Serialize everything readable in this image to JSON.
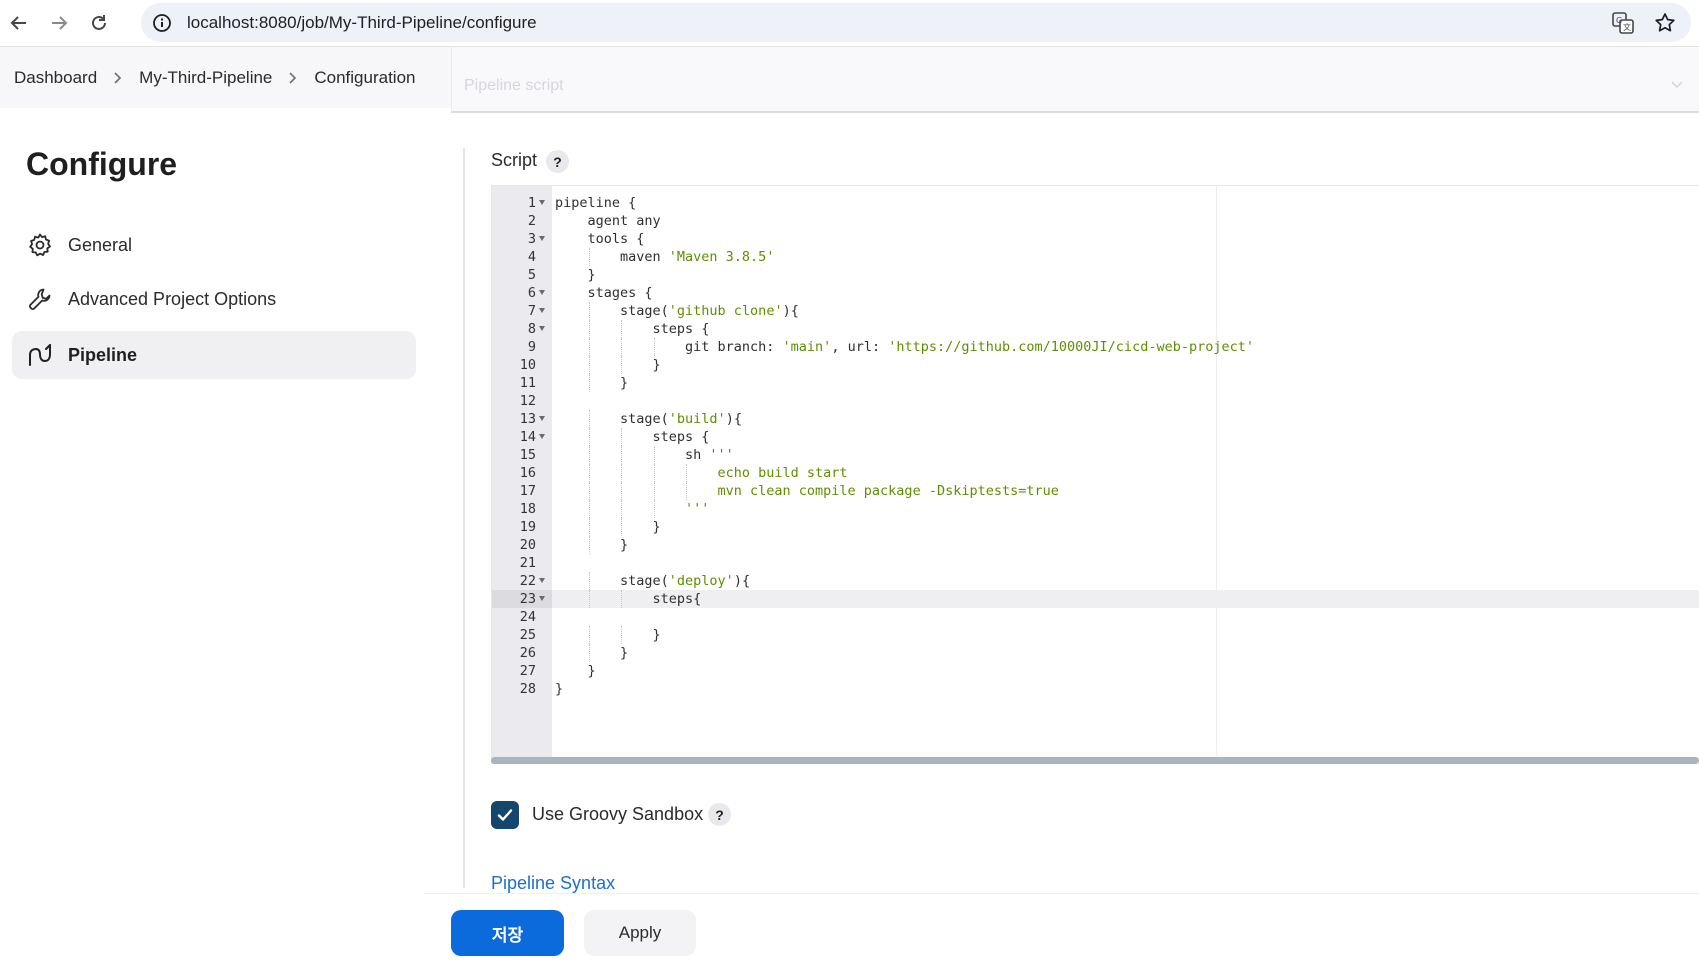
{
  "browser": {
    "url": "localhost:8080/job/My-Third-Pipeline/configure",
    "icons": [
      "back-arrow-icon",
      "forward-arrow-icon",
      "reload-icon",
      "info-icon",
      "translate-icon",
      "star-icon"
    ]
  },
  "breadcrumb": [
    "Dashboard",
    "My-Third-Pipeline",
    "Configuration"
  ],
  "definition_select": {
    "value": "Pipeline script"
  },
  "sidebar": {
    "title": "Configure",
    "items": [
      {
        "label": "General",
        "icon": "gear-icon"
      },
      {
        "label": "Advanced Project Options",
        "icon": "wrench-icon"
      },
      {
        "label": "Pipeline",
        "icon": "pipeline-icon",
        "active": true
      }
    ]
  },
  "script": {
    "label": "Script",
    "help": "?",
    "active_line": 23,
    "lines": [
      {
        "n": "1",
        "fold": true,
        "indent": 0,
        "parts": [
          {
            "t": "pipeline {"
          }
        ]
      },
      {
        "n": "2",
        "fold": false,
        "indent": 1,
        "parts": [
          {
            "t": "agent any"
          }
        ]
      },
      {
        "n": "3",
        "fold": true,
        "indent": 1,
        "parts": [
          {
            "t": "tools {"
          }
        ]
      },
      {
        "n": "4",
        "fold": false,
        "indent": 2,
        "parts": [
          {
            "t": "maven "
          },
          {
            "t": "'Maven 3.8.5'",
            "s": true
          }
        ]
      },
      {
        "n": "5",
        "fold": false,
        "indent": 1,
        "parts": [
          {
            "t": "}"
          }
        ]
      },
      {
        "n": "6",
        "fold": true,
        "indent": 1,
        "parts": [
          {
            "t": "stages {"
          }
        ]
      },
      {
        "n": "7",
        "fold": true,
        "indent": 2,
        "parts": [
          {
            "t": "stage("
          },
          {
            "t": "'github clone'",
            "s": true
          },
          {
            "t": "){"
          }
        ]
      },
      {
        "n": "8",
        "fold": true,
        "indent": 3,
        "parts": [
          {
            "t": "steps {"
          }
        ]
      },
      {
        "n": "9",
        "fold": false,
        "indent": 4,
        "parts": [
          {
            "t": "git branch: "
          },
          {
            "t": "'main'",
            "s": true
          },
          {
            "t": ", url: "
          },
          {
            "t": "'https://github.com/10000JI/cicd-web-project'",
            "s": true
          }
        ]
      },
      {
        "n": "10",
        "fold": false,
        "indent": 3,
        "parts": [
          {
            "t": "}"
          }
        ]
      },
      {
        "n": "11",
        "fold": false,
        "indent": 2,
        "parts": [
          {
            "t": "}"
          }
        ]
      },
      {
        "n": "12",
        "fold": false,
        "indent": 0,
        "parts": []
      },
      {
        "n": "13",
        "fold": true,
        "indent": 2,
        "parts": [
          {
            "t": "stage("
          },
          {
            "t": "'build'",
            "s": true
          },
          {
            "t": "){"
          }
        ]
      },
      {
        "n": "14",
        "fold": true,
        "indent": 3,
        "parts": [
          {
            "t": "steps {"
          }
        ]
      },
      {
        "n": "15",
        "fold": false,
        "indent": 4,
        "parts": [
          {
            "t": "sh "
          },
          {
            "t": "'''",
            "s": true
          }
        ]
      },
      {
        "n": "16",
        "fold": false,
        "indent": 5,
        "parts": [
          {
            "t": "echo build start",
            "s": true
          }
        ]
      },
      {
        "n": "17",
        "fold": false,
        "indent": 5,
        "parts": [
          {
            "t": "mvn clean compile package -Dskiptests=true",
            "s": true
          }
        ]
      },
      {
        "n": "18",
        "fold": false,
        "indent": 4,
        "parts": [
          {
            "t": "'''",
            "s": true
          }
        ]
      },
      {
        "n": "19",
        "fold": false,
        "indent": 3,
        "parts": [
          {
            "t": "}"
          }
        ]
      },
      {
        "n": "20",
        "fold": false,
        "indent": 2,
        "parts": [
          {
            "t": "}"
          }
        ]
      },
      {
        "n": "21",
        "fold": false,
        "indent": 0,
        "parts": []
      },
      {
        "n": "22",
        "fold": true,
        "indent": 2,
        "parts": [
          {
            "t": "stage("
          },
          {
            "t": "'deploy'",
            "s": true
          },
          {
            "t": "){"
          }
        ]
      },
      {
        "n": "23",
        "fold": true,
        "indent": 3,
        "parts": [
          {
            "t": "steps{"
          }
        ]
      },
      {
        "n": "24",
        "fold": false,
        "indent": 0,
        "parts": []
      },
      {
        "n": "25",
        "fold": false,
        "indent": 3,
        "parts": [
          {
            "t": "}"
          }
        ]
      },
      {
        "n": "26",
        "fold": false,
        "indent": 2,
        "parts": [
          {
            "t": "}"
          }
        ]
      },
      {
        "n": "27",
        "fold": false,
        "indent": 1,
        "parts": [
          {
            "t": "}"
          }
        ]
      },
      {
        "n": "28",
        "fold": false,
        "indent": 0,
        "parts": [
          {
            "t": "}"
          }
        ]
      }
    ]
  },
  "sandbox": {
    "label": "Use Groovy Sandbox",
    "checked": true,
    "help": "?"
  },
  "links": {
    "pipeline_syntax": "Pipeline Syntax"
  },
  "buttons": {
    "save": "저장",
    "apply": "Apply"
  },
  "colors": {
    "primary": "#0b6bdc",
    "checkbox": "#14476b",
    "link": "#1a6fd0",
    "string": "#5f8f00"
  }
}
